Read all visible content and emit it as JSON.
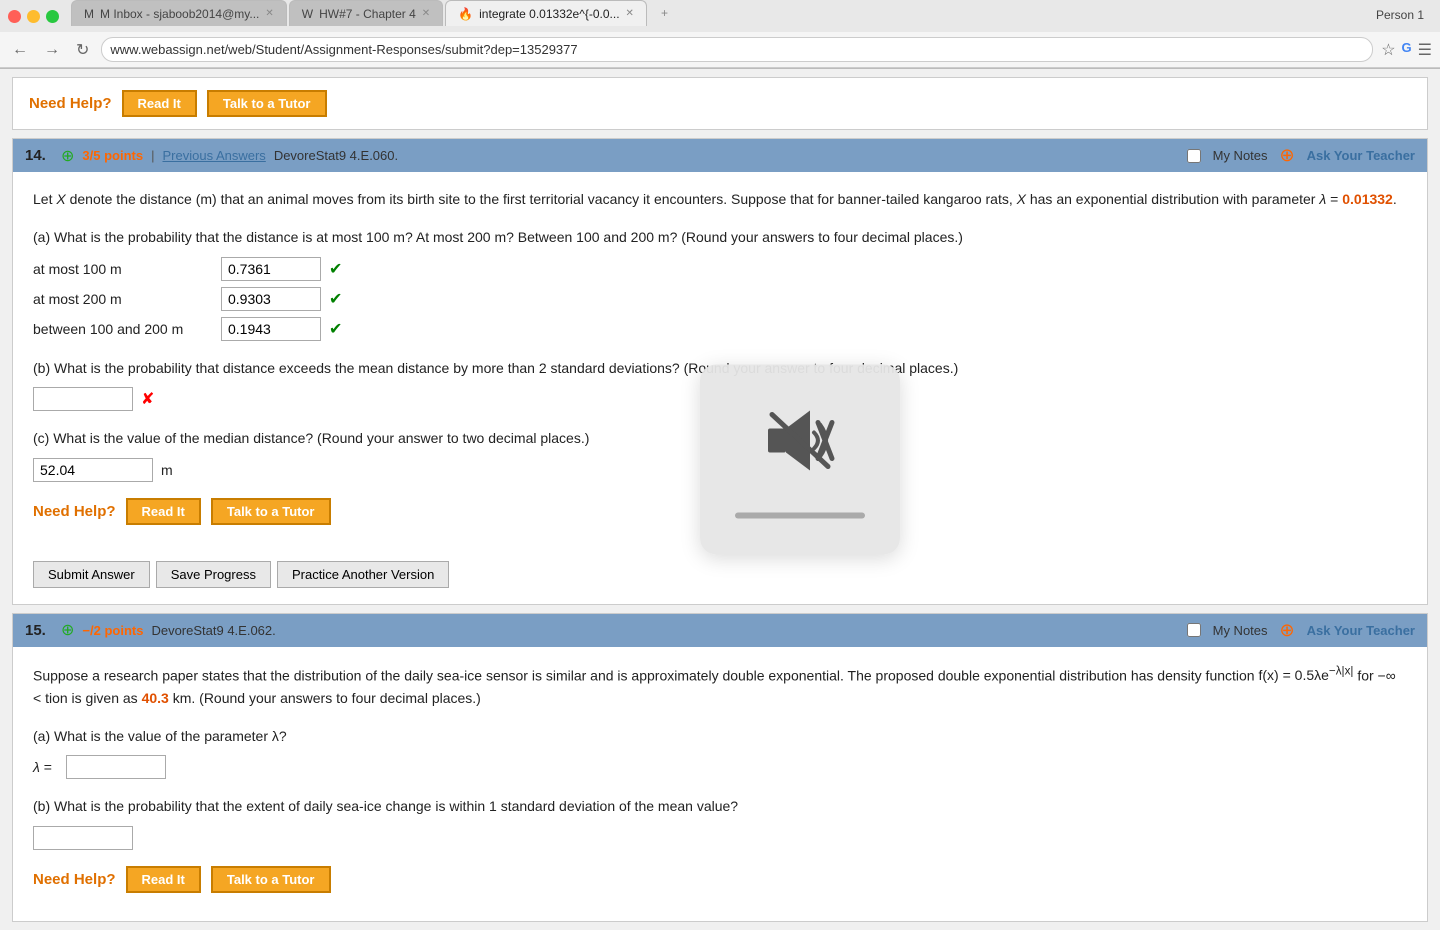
{
  "browser": {
    "tabs": [
      {
        "label": "M Inbox - sjaboob2014@my...",
        "icon": "M",
        "active": false
      },
      {
        "label": "HW#7 - Chapter 4",
        "icon": "W",
        "active": false
      },
      {
        "label": "integrate 0.01332e^{-0.0...",
        "icon": "🔥",
        "active": true
      }
    ],
    "url": "www.webassign.net/web/Student/Assignment-Responses/submit?dep=13529377",
    "person": "Person 1"
  },
  "top_section": {
    "need_help_label": "Need Help?",
    "read_it": "Read It",
    "talk_to_tutor": "Talk to a Tutor"
  },
  "question14": {
    "number": "14.",
    "points": "3/5 points",
    "prev_answers": "Previous Answers",
    "source": "DevoreStat9 4.E.060.",
    "my_notes": "My Notes",
    "ask_teacher": "Ask Your Teacher",
    "text_p1": "Let X denote the distance (m) that an animal moves from its birth site to the first territorial vacancy it encounters. Suppose that for banner-tailed kangaroo rats,",
    "text_x": "X",
    "text_p2": "has an exponential distribution with parameter",
    "lambda_sym": "λ",
    "equals": "=",
    "lambda_val": "0.01332",
    "part_a_text": "(a) What is the probability that the distance is at most 100 m? At most 200 m? Between 100 and 200 m? (Round your answers to four decimal places.)",
    "at_most_100": "at most 100 m",
    "val_100": "0.7361",
    "at_most_200": "at most 200 m",
    "val_200": "0.9303",
    "between_label": "between 100 and 200 m",
    "val_between": "0.1943",
    "part_b_text": "(b) What is the probability that distance exceeds the mean distance by more than 2 standard deviations? (Round your answer to four decimal places.)",
    "part_c_text": "(c) What is the value of the median distance? (Round your answer to two decimal places.)",
    "median_val": "52.04",
    "median_unit": "m",
    "need_help_label": "Need Help?",
    "read_it": "Read It",
    "talk_to_tutor": "Talk to a Tutor",
    "submit": "Submit Answer",
    "save": "Save Progress",
    "practice": "Practice Another Version"
  },
  "question15": {
    "number": "15.",
    "points": "−/2 points",
    "source": "DevoreStat9 4.E.062.",
    "my_notes": "My Notes",
    "ask_teacher": "Ask Your Teacher",
    "text_p1": "Suppose a research paper states that the distribution of the daily sea-ice",
    "text_p2": "sensor is similar and is approximately double exponential. The proposed double exponential distribution has density function",
    "formula": "f(x) = 0.5λe",
    "formula2": "−λ|x|",
    "formula3": "for −∞ <",
    "text_p3": "tion is given as",
    "val_highlight": "40.3",
    "text_p4": "km. (Round your answers to four decimal places.)",
    "part_a_text": "(a) What is the value of the parameter λ?",
    "lambda_sym": "λ",
    "equals": "=",
    "part_b_text": "(b) What is the probability that the extent of daily sea-ice change is within 1 standard deviation of the mean value?",
    "need_help_label": "Need Help?",
    "read_it": "Read It",
    "talk_to_tutor": "Talk to a Tutor"
  }
}
